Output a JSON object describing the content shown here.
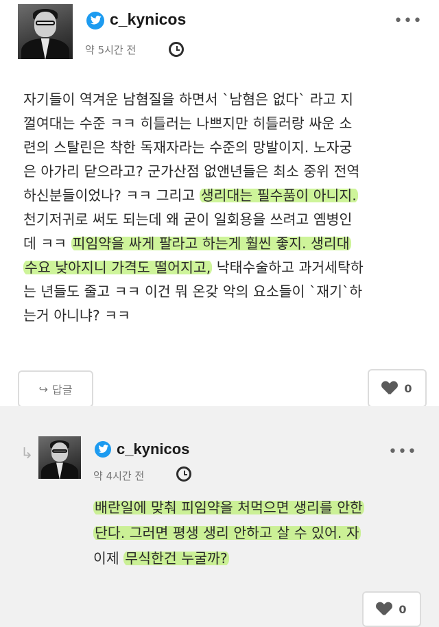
{
  "post": {
    "username": "c_kynicos",
    "time": "약 5시간 전",
    "more": "•••",
    "lines": [
      [
        {
          "t": "자기들이 역겨운 남혐질을 하면서 `남혐은 없다` 라고 지"
        }
      ],
      [
        {
          "t": "껄여대는 수준 ㅋㅋ 히틀러는 나쁘지만 히틀러랑 싸운 소"
        }
      ],
      [
        {
          "t": "련의 스탈린은 착한 독재자라는 수준의 망발이지. 노자궁"
        }
      ],
      [
        {
          "t": "은 아가리 닫으라고? 군가산점 없앤년들은 최소 중위 전역"
        }
      ],
      [
        {
          "t": "하신분들이었나? ㅋㅋ 그리고 "
        },
        {
          "t": "생리대는 필수품이 아니지.",
          "h": true
        }
      ],
      [
        {
          "t": "천기저귀로 써도 되는데 왜 굳이 일회용을 쓰려고 옘병인"
        }
      ],
      [
        {
          "t": "데 ㅋㅋ "
        },
        {
          "t": "피임약을 싸게 팔라고 하는게 훨씬 좋지. 생리대",
          "h": true
        }
      ],
      [
        {
          "t": "수요 낮아지니 가격도 떨어지고,",
          "h": true
        },
        {
          "t": " 낙태수술하고 과거세탁하"
        }
      ],
      [
        {
          "t": "는 년들도 줄고 ㅋㅋ 이건 뭐 온갖 악의 요소들이 `재기`하"
        }
      ],
      [
        {
          "t": "는거 아니냐? ㅋㅋ"
        }
      ]
    ],
    "reply_label": "답글",
    "like_count": "0"
  },
  "reply": {
    "username": "c_kynicos",
    "time": "약 4시간 전",
    "more": "•••",
    "lines": [
      [
        {
          "t": "배란일에 맞춰 피임약을 처먹으면 생리를 안한",
          "h": true
        }
      ],
      [
        {
          "t": "단다. 그러면 평생 생리 안하고 살 수 있어. 자",
          "h": true
        }
      ],
      [
        {
          "t": "이제 "
        },
        {
          "t": "무식한건 누굴까?",
          "h": true
        }
      ]
    ],
    "like_count": "0"
  },
  "icons": {
    "reply_arrow": "reply-arrow-icon",
    "twitter": "twitter-bird-icon",
    "clock": "clock-icon",
    "heart": "heart-icon",
    "share_arrow": "share-arrow-icon"
  },
  "colors": {
    "highlight": "#bef078",
    "twitter_blue": "#1d9bf0",
    "reply_bg": "#f1f1f1"
  }
}
